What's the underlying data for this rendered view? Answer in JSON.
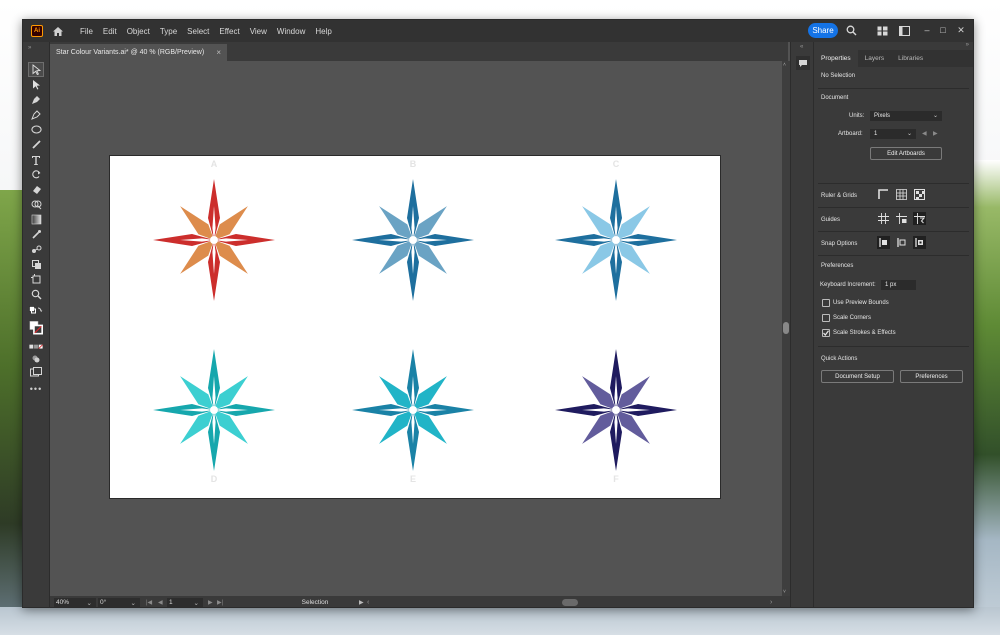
{
  "app": {
    "logo": "Ai",
    "menu": [
      "File",
      "Edit",
      "Object",
      "Type",
      "Select",
      "Effect",
      "View",
      "Window",
      "Help"
    ],
    "share": "Share"
  },
  "doc_tab": {
    "title": "Star Colour Variants.ai* @ 40 % (RGB/Preview)",
    "close": "×"
  },
  "stars": [
    {
      "label": "A",
      "outer": "#cc2e2c",
      "inner": "#dd8c4c"
    },
    {
      "label": "B",
      "outer": "#1e6f9e",
      "inner": "#6aa3c4"
    },
    {
      "label": "C",
      "outer": "#1e6f9e",
      "inner": "#8ac8e6"
    },
    {
      "label": "D",
      "outer": "#16a7ad",
      "inner": "#3ccfd1"
    },
    {
      "label": "E",
      "outer": "#1a82a6",
      "inner": "#21b4c7"
    },
    {
      "label": "F",
      "outer": "#1f1b5f",
      "inner": "#625c9c"
    }
  ],
  "status": {
    "zoom": "40%",
    "rotate": "0°",
    "artboard": "1",
    "tool": "Selection"
  },
  "panel": {
    "tabs": [
      "Properties",
      "Layers",
      "Libraries"
    ],
    "no_selection": "No Selection",
    "document": "Document",
    "units_label": "Units:",
    "units_value": "Pixels",
    "artboard_label": "Artboard:",
    "artboard_value": "1",
    "edit_artboards": "Edit Artboards",
    "rulers": "Ruler & Grids",
    "guides": "Guides",
    "snap": "Snap Options",
    "preferences": "Preferences",
    "keyboard_increment_label": "Keyboard Increment:",
    "keyboard_increment_value": "1 px",
    "checkboxes": [
      {
        "label": "Use Preview Bounds",
        "checked": false
      },
      {
        "label": "Scale Corners",
        "checked": false
      },
      {
        "label": "Scale Strokes & Effects",
        "checked": true
      }
    ],
    "quick_actions": "Quick Actions",
    "document_setup": "Document Setup",
    "preferences_btn": "Preferences"
  },
  "colors": {
    "accent": "#1473e6",
    "ui_dark": "#323232",
    "ui_panel": "#3a3a3a",
    "canvas": "#535353"
  }
}
